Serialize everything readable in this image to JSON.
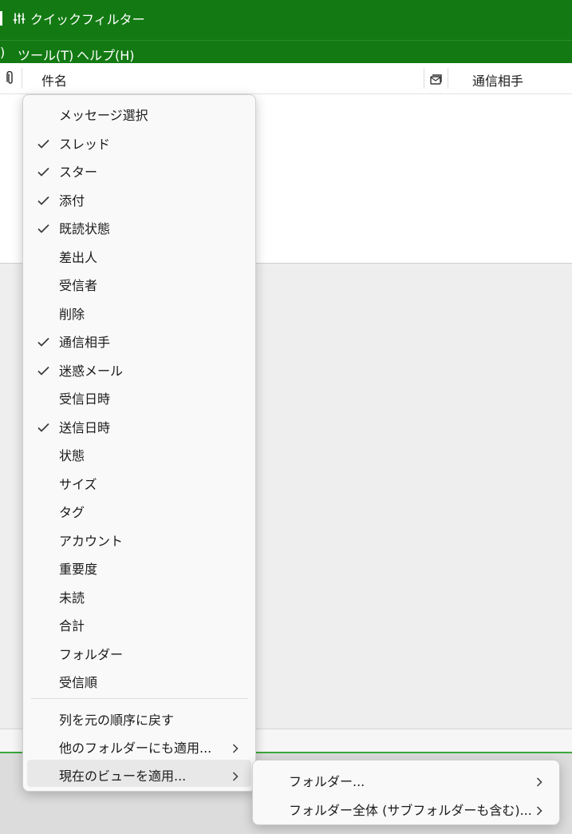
{
  "toolbar": {
    "quick_filter_label": "クイックフィルター",
    "icon": "sliders-icon",
    "background": "#137a13"
  },
  "menubar": {
    "items": [
      ")",
      "ツール(T)",
      "ヘルプ(H)"
    ]
  },
  "thread_header": {
    "attachment_icon": "paperclip-icon",
    "subject": "件名",
    "unread_icon": "mail-stack-icon",
    "correspondents": "通信相手"
  },
  "column_menu": {
    "items": [
      {
        "label": "メッセージ選択",
        "checked": false
      },
      {
        "label": "スレッド",
        "checked": true
      },
      {
        "label": "スター",
        "checked": true
      },
      {
        "label": "添付",
        "checked": true
      },
      {
        "label": "既読状態",
        "checked": true
      },
      {
        "label": "差出人",
        "checked": false
      },
      {
        "label": "受信者",
        "checked": false
      },
      {
        "label": "削除",
        "checked": false
      },
      {
        "label": "通信相手",
        "checked": true
      },
      {
        "label": "迷惑メール",
        "checked": true
      },
      {
        "label": "受信日時",
        "checked": false
      },
      {
        "label": "送信日時",
        "checked": true
      },
      {
        "label": "状態",
        "checked": false
      },
      {
        "label": "サイズ",
        "checked": false
      },
      {
        "label": "タグ",
        "checked": false
      },
      {
        "label": "アカウント",
        "checked": false
      },
      {
        "label": "重要度",
        "checked": false
      },
      {
        "label": "未読",
        "checked": false
      },
      {
        "label": "合計",
        "checked": false
      },
      {
        "label": "フォルダー",
        "checked": false
      },
      {
        "label": "受信順",
        "checked": false
      }
    ],
    "actions": [
      {
        "label": "列を元の順序に戻す",
        "submenu": false
      },
      {
        "label": "他のフォルダーにも適用...",
        "submenu": true
      },
      {
        "label": "現在のビューを適用...",
        "submenu": true,
        "highlighted": true
      }
    ]
  },
  "apply_view_submenu": {
    "items": [
      {
        "label": "フォルダー..."
      },
      {
        "label": "フォルダー全体 (サブフォルダーも含む)..."
      }
    ]
  }
}
